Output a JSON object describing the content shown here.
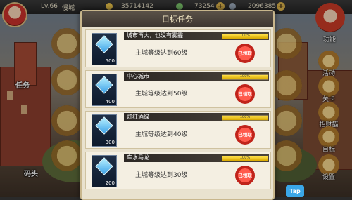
{
  "colors": {
    "accent": "#e0b24a",
    "claimed_red": "#c0241b",
    "progress_yellow": "#ffe14a"
  },
  "top_bar": {
    "level": "Lv.66",
    "player_name": "慢城",
    "gold": "35714142",
    "food": "73254",
    "iron": "2096385"
  },
  "right_menu": [
    "功能",
    "活动",
    "关卡",
    "招财猫",
    "目标",
    "设置"
  ],
  "left_menu": [
    "任务",
    "码头"
  ],
  "modal": {
    "title": "目标任务",
    "tasks": [
      {
        "name": "城市再大，也没有雾霾",
        "progress_text": "100%",
        "progress": 1.0,
        "reward": "500",
        "desc": "主城等级达到60级",
        "status": "已领取"
      },
      {
        "name": "中心城市",
        "progress_text": "100%",
        "progress": 1.0,
        "reward": "400",
        "desc": "主城等级达到50级",
        "status": "已领取"
      },
      {
        "name": "灯红酒绿",
        "progress_text": "100%",
        "progress": 1.0,
        "reward": "300",
        "desc": "主城等级达到40级",
        "status": "已领取"
      },
      {
        "name": "车水马龙",
        "progress_text": "100%",
        "progress": 1.0,
        "reward": "200",
        "desc": "主城等级达到30级",
        "status": "已领取"
      }
    ]
  },
  "tap_label": "Tap",
  "icons": [
    "gold-coin-icon",
    "food-icon",
    "iron-icon",
    "diamond-reward-icon"
  ]
}
